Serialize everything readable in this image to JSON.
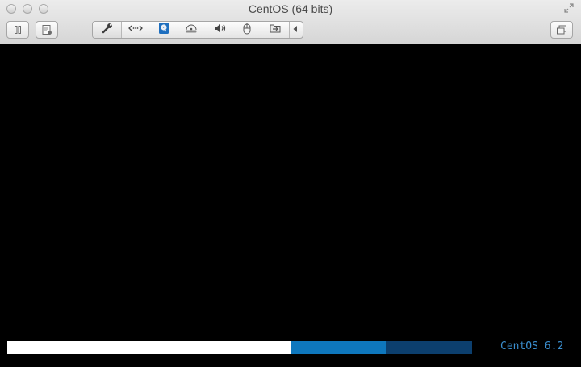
{
  "window": {
    "title": "CentOS (64 bits)"
  },
  "toolbar": {
    "left_buttons": [
      "pause-icon",
      "snapshot-icon"
    ],
    "devices": [
      "wrench-icon",
      "network-icon",
      "harddisk-icon",
      "optical-drive-icon",
      "speaker-icon",
      "usb-mouse-icon",
      "shared-folder-icon",
      "collapse-arrow-icon"
    ],
    "right_button": "windows-icon"
  },
  "boot": {
    "brand": "CentOS 6.2",
    "progress": {
      "white_fraction": 0.611,
      "light_blue_fraction": 0.203
    },
    "colors": {
      "white": "#ffffff",
      "light_blue": "#0e77bd",
      "dark_blue": "#0c3f6e",
      "brand": "#3a8fd0"
    }
  }
}
